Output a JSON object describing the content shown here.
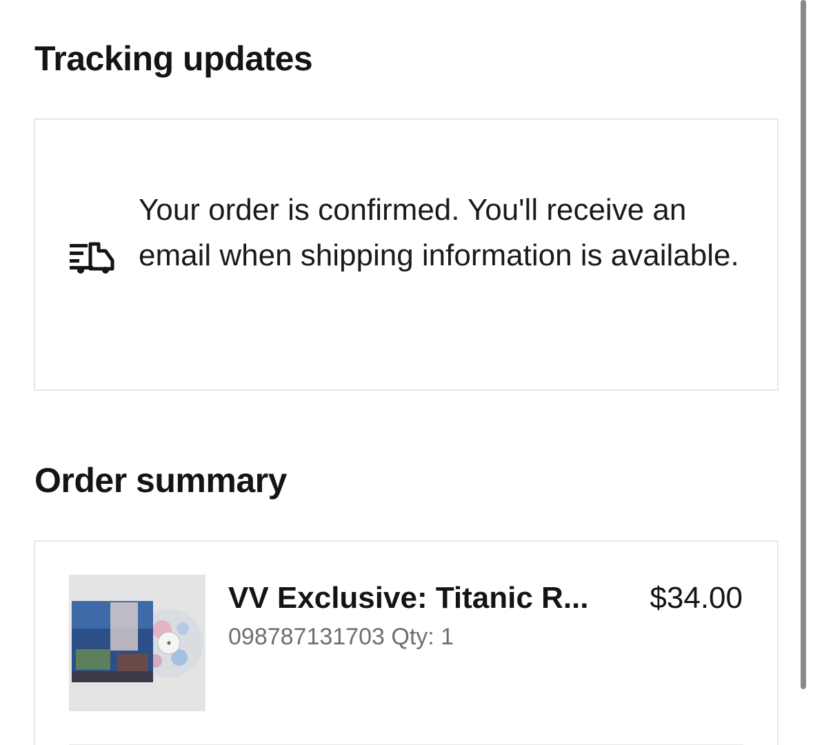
{
  "tracking": {
    "title": "Tracking updates",
    "message": "Your order is confirmed. You'll receive an email when shipping information is available.",
    "icon": "truck-icon"
  },
  "summary": {
    "title": "Order summary",
    "item": {
      "name": "VV Exclusive: Titanic R...",
      "sku": "098787131703",
      "qty_label": "Qty: 1",
      "price": "$34.00",
      "image": "vinyl-record-product-image"
    }
  }
}
